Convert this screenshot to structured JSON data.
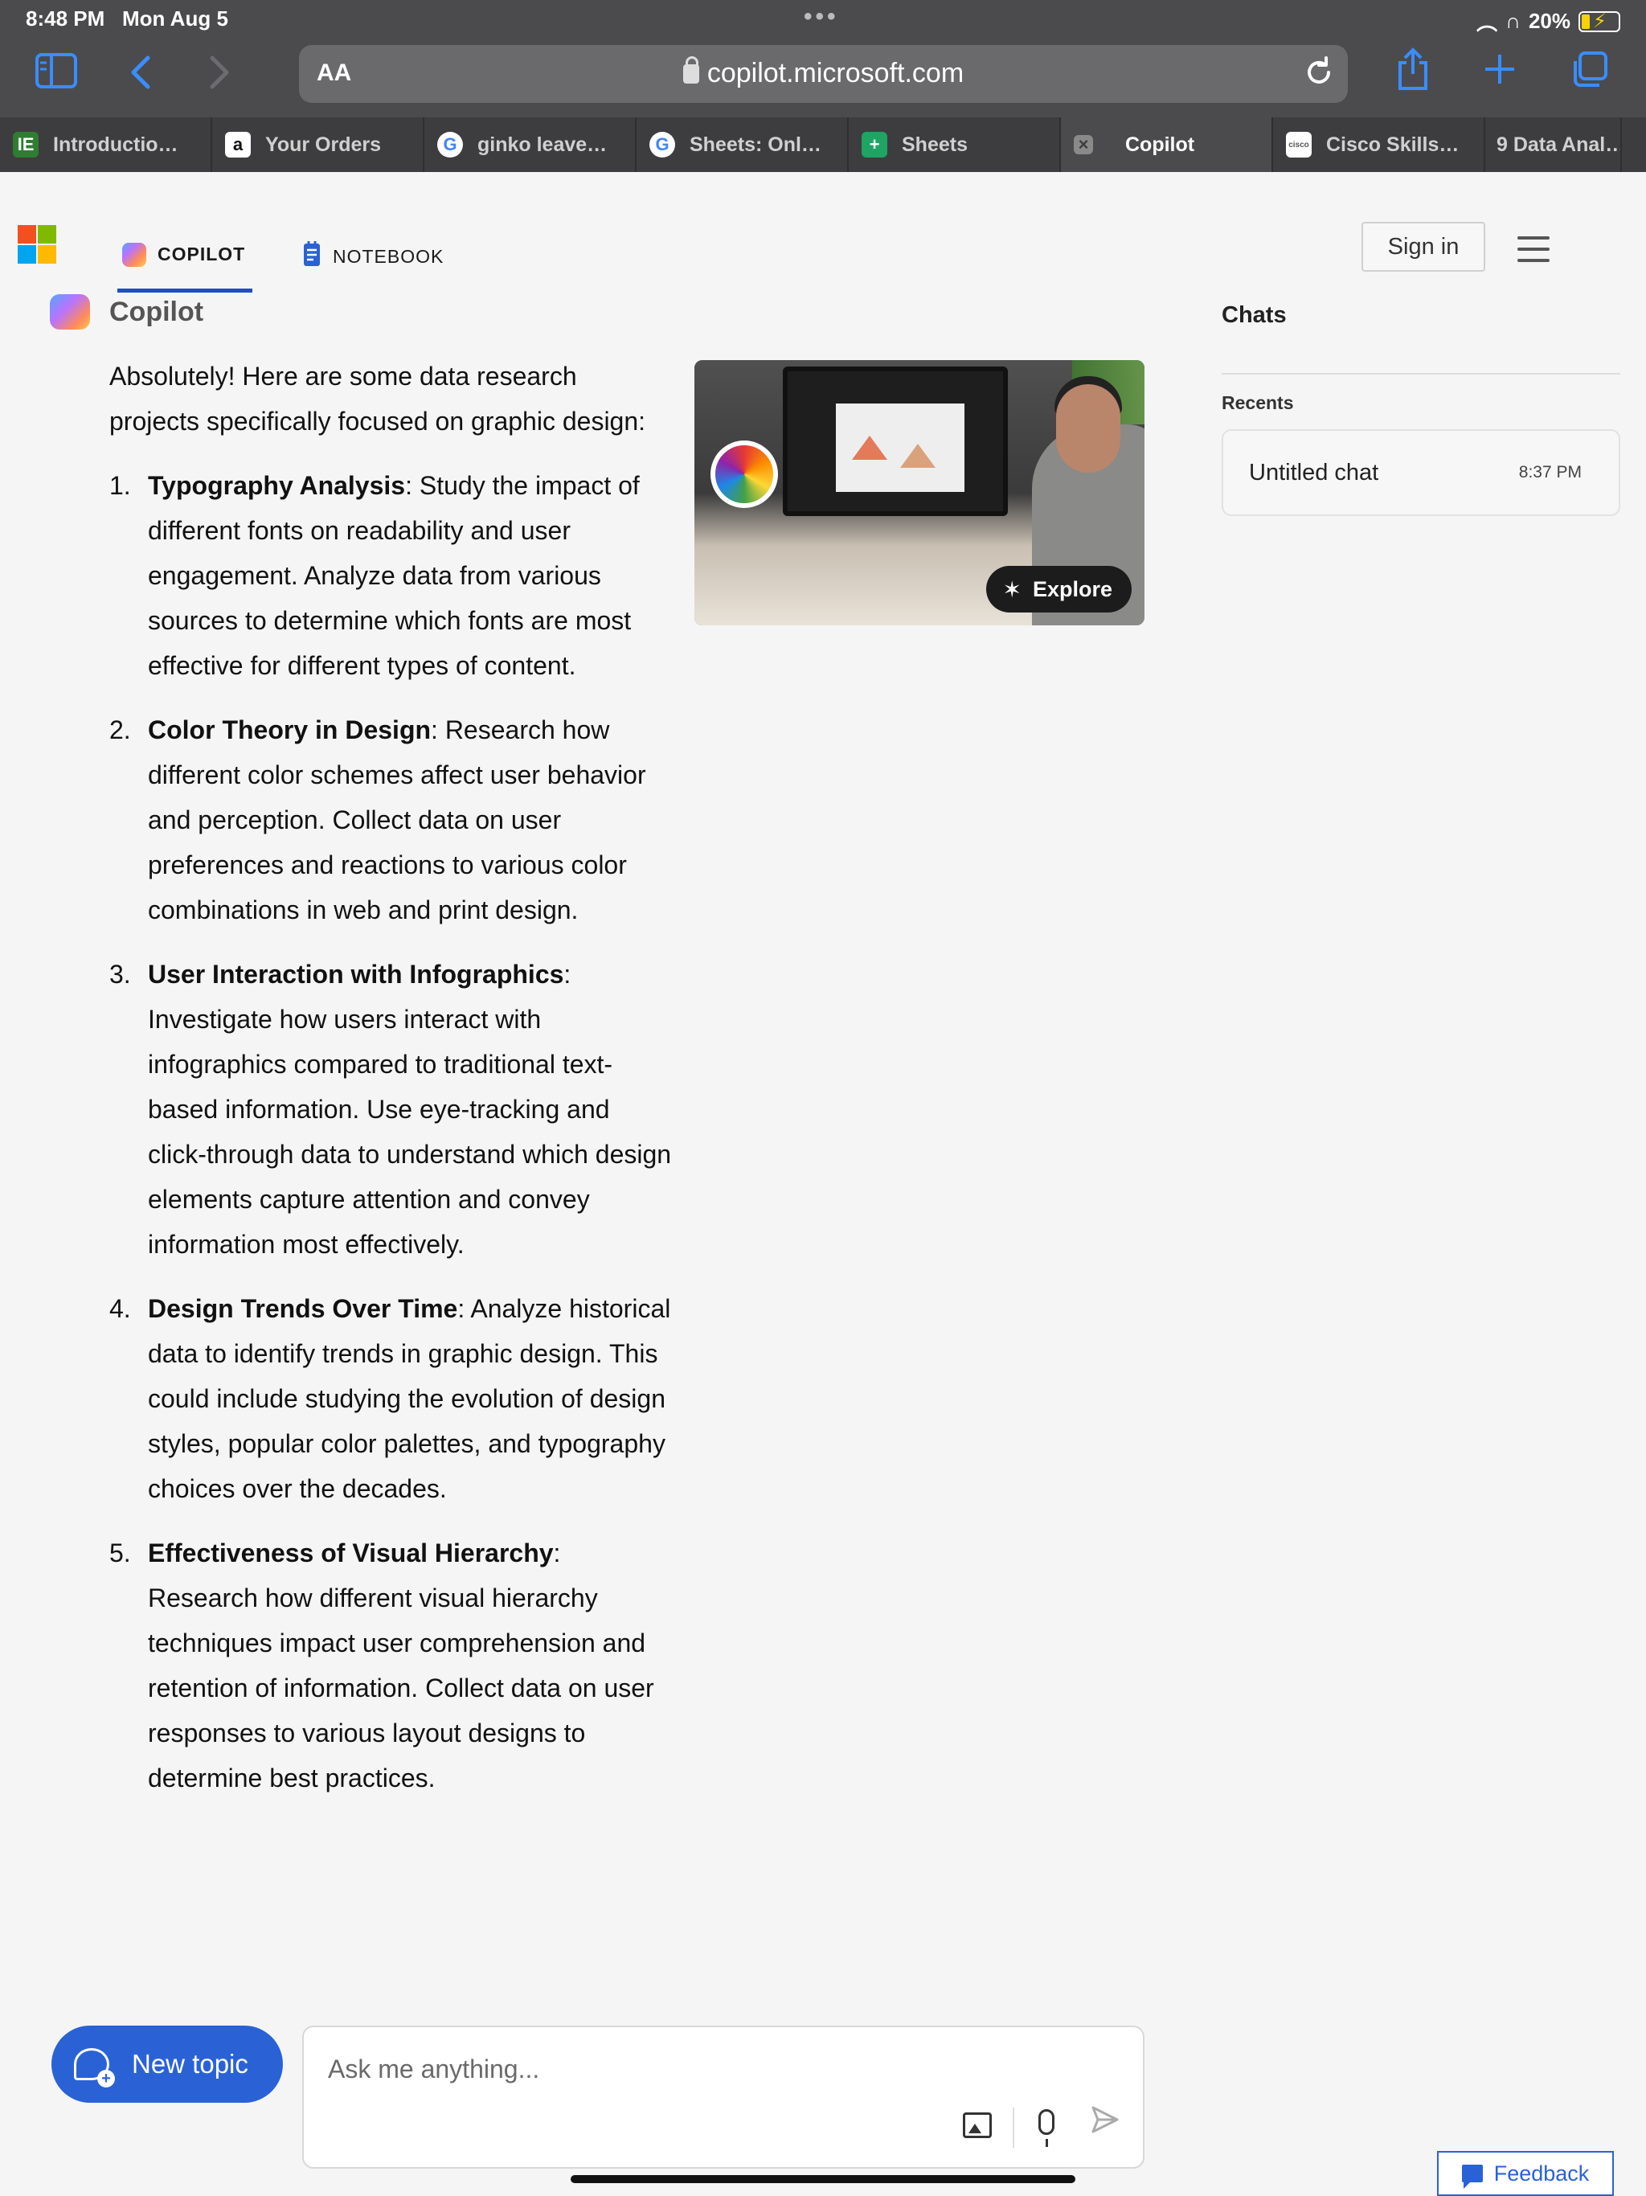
{
  "status_bar": {
    "time": "8:48 PM",
    "date": "Mon Aug 5",
    "battery": "20%"
  },
  "browser": {
    "aa_label": "AA",
    "url": "copilot.microsoft.com",
    "accent_color": "#3a8dff"
  },
  "tabs": [
    {
      "label": "Introductio…",
      "favicon": "IE",
      "fav_bg": "#2f7d32",
      "fav_color": "#fff"
    },
    {
      "label": "Your Orders",
      "favicon": "a",
      "fav_bg": "#ffffff",
      "fav_color": "#111"
    },
    {
      "label": "ginko leave…",
      "favicon": "G",
      "fav_bg": "#ffffff",
      "fav_color": "#4285f4"
    },
    {
      "label": "Sheets: Onl…",
      "favicon": "G",
      "fav_bg": "#ffffff",
      "fav_color": "#4285f4"
    },
    {
      "label": "Sheets",
      "favicon": "+",
      "fav_bg": "#1fa463",
      "fav_color": "#fff"
    },
    {
      "label": "Copilot",
      "favicon": "×",
      "fav_bg": "#8a8a8a",
      "fav_color": "#3d3d3f",
      "active": true
    },
    {
      "label": "Cisco Skills…",
      "favicon": "cisco",
      "fav_bg": "#ffffff",
      "fav_color": "#555"
    },
    {
      "label": "9 Data Anal…",
      "favicon": "",
      "fav_bg": "",
      "fav_color": ""
    }
  ],
  "nav": {
    "copilot_tab": "COPILOT",
    "notebook_tab": "NOTEBOOK",
    "sign_in": "Sign in"
  },
  "assistant_name": "Copilot",
  "answer": {
    "intro": "Absolutely! Here are some data research projects specifically focused on graphic design:",
    "items": [
      {
        "num": "1.",
        "title": "Typography Analysis",
        "text": ": Study the impact of different fonts on readability and user engagement. Analyze data from various sources to determine which fonts are most effective for different types of content."
      },
      {
        "num": "2.",
        "title": "Color Theory in Design",
        "text": ": Research how different color schemes affect user behavior and perception. Collect data on user preferences and reactions to various color combinations in web and print design."
      },
      {
        "num": "3.",
        "title": "User Interaction with Infographics",
        "text": ": Investigate how users interact with infographics compared to traditional text-based information. Use eye-tracking and click-through data to understand which design elements capture attention and convey information most effectively."
      },
      {
        "num": "4.",
        "title": "Design Trends Over Time",
        "text": ": Analyze historical data to identify trends in graphic design. This could include studying the evolution of design styles, popular color palettes, and typography choices over the decades."
      },
      {
        "num": "5.",
        "title": "Effectiveness of Visual Hierarchy",
        "text": ": Research how different visual hierarchy techniques impact user comprehension and retention of information. Collect data on user responses to various layout designs to determine best practices."
      }
    ]
  },
  "image_card": {
    "explore_label": "Explore"
  },
  "side_panel": {
    "title": "Chats",
    "recents_label": "Recents",
    "chats": [
      {
        "title": "Untitled chat",
        "time": "8:37 PM"
      }
    ]
  },
  "composer": {
    "new_topic": "New topic",
    "placeholder": "Ask me anything..."
  },
  "feedback_label": "Feedback"
}
